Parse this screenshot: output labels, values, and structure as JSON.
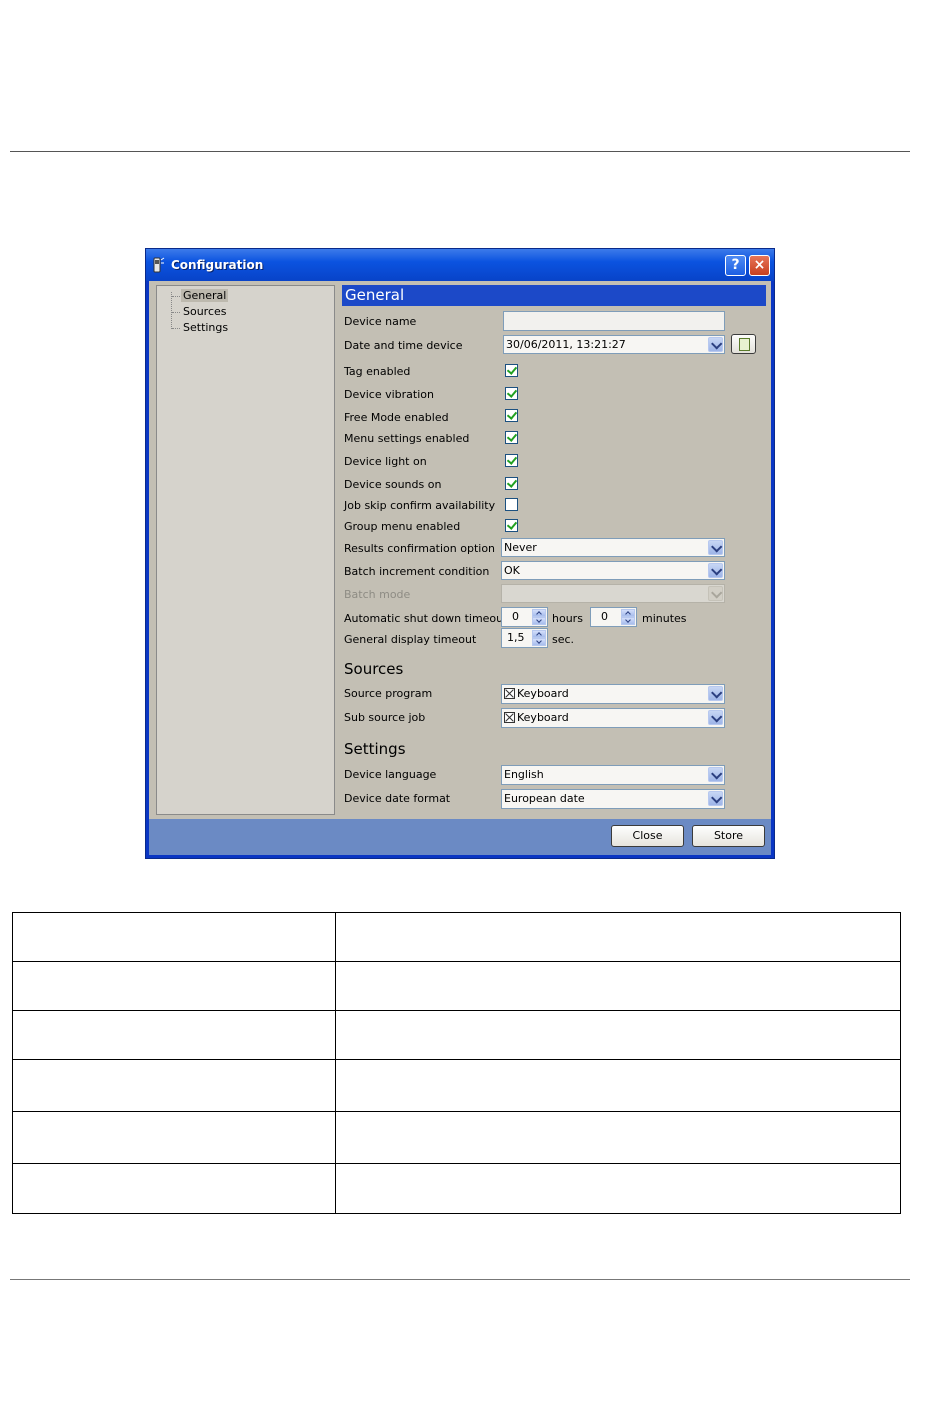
{
  "window": {
    "title": "Configuration",
    "help_label": "?",
    "close_label": "×"
  },
  "tree": {
    "items": [
      {
        "label": "General",
        "selected": true
      },
      {
        "label": "Sources",
        "selected": false
      },
      {
        "label": "Settings",
        "selected": false
      }
    ]
  },
  "general": {
    "header": "General",
    "device_name": {
      "label": "Device name",
      "value": ""
    },
    "date_time": {
      "label": "Date and time device",
      "value": "30/06/2011, 13:21:27"
    },
    "checkboxes": [
      {
        "label": "Tag enabled",
        "checked": true
      },
      {
        "label": "Device vibration",
        "checked": true
      },
      {
        "label": "Free Mode enabled",
        "checked": true
      },
      {
        "label": "Menu settings enabled",
        "checked": true
      },
      {
        "label": "Device light on",
        "checked": true
      },
      {
        "label": "Device sounds on",
        "checked": true
      },
      {
        "label": "Job skip confirm availability",
        "checked": false
      },
      {
        "label": "Group menu enabled",
        "checked": true
      }
    ],
    "results_confirmation": {
      "label": "Results confirmation option",
      "value": "Never"
    },
    "batch_increment": {
      "label": "Batch increment condition",
      "value": "OK"
    },
    "batch_mode": {
      "label": "Batch mode",
      "value": "",
      "disabled": true
    },
    "shutdown": {
      "label": "Automatic shut down timeout",
      "hours": "0",
      "hours_unit": "hours",
      "minutes": "0",
      "minutes_unit": "minutes"
    },
    "display_timeout": {
      "label": "General display timeout",
      "value": "1,5",
      "unit": "sec."
    }
  },
  "sources": {
    "header": "Sources",
    "source_program": {
      "label": "Source program",
      "value": "Keyboard",
      "icon": "keyboard-icon"
    },
    "sub_source_job": {
      "label": "Sub source job",
      "value": "Keyboard",
      "icon": "keyboard-icon"
    }
  },
  "settings": {
    "header": "Settings",
    "device_language": {
      "label": "Device language",
      "value": "English"
    },
    "date_format": {
      "label": "Device date format",
      "value": "European date"
    }
  },
  "footer": {
    "close_label": "Close",
    "store_label": "Store"
  },
  "colors": {
    "title_bar": "#0b53e0",
    "section_bar": "#1c49c8",
    "client_bg": "#c3bfb4",
    "footer_bg": "#6b8ac4"
  }
}
